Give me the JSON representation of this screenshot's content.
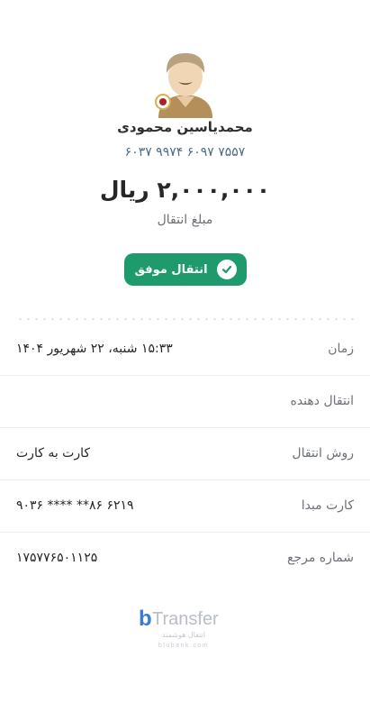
{
  "sender": {
    "name": "محمدیاسین محمودی",
    "card_number": "۶۰۳۷ ۹۹۷۴ ۶۰۹۷ ۷۵۵۷"
  },
  "amount": {
    "value": "۲,۰۰۰,۰۰۰ ریال",
    "label": "مبلغ انتقال"
  },
  "status": {
    "label": "انتقال موفق",
    "icon": "check-icon",
    "color": "#1f9a6c"
  },
  "details": [
    {
      "key": "زمان",
      "value": "۱۵:۳۳ شنبه، ۲۲ شهریور ۱۴۰۴"
    },
    {
      "key": "انتقال دهنده",
      "value": ""
    },
    {
      "key": "روش انتقال",
      "value": "کارت به کارت"
    },
    {
      "key": "کارت مبدا",
      "value": "۶۲۱۹ ۸۶** **** ۹۰۳۶"
    },
    {
      "key": "شماره مرجع",
      "value": "۱۷۵۷۷۶۵۰۱۱۲۵"
    }
  ],
  "brand": {
    "logo_text": "Transfer",
    "logo_mark": "b",
    "tagline": "انتقال هوشمند",
    "site": "blubank.com",
    "accent": "#3b7bd6"
  }
}
